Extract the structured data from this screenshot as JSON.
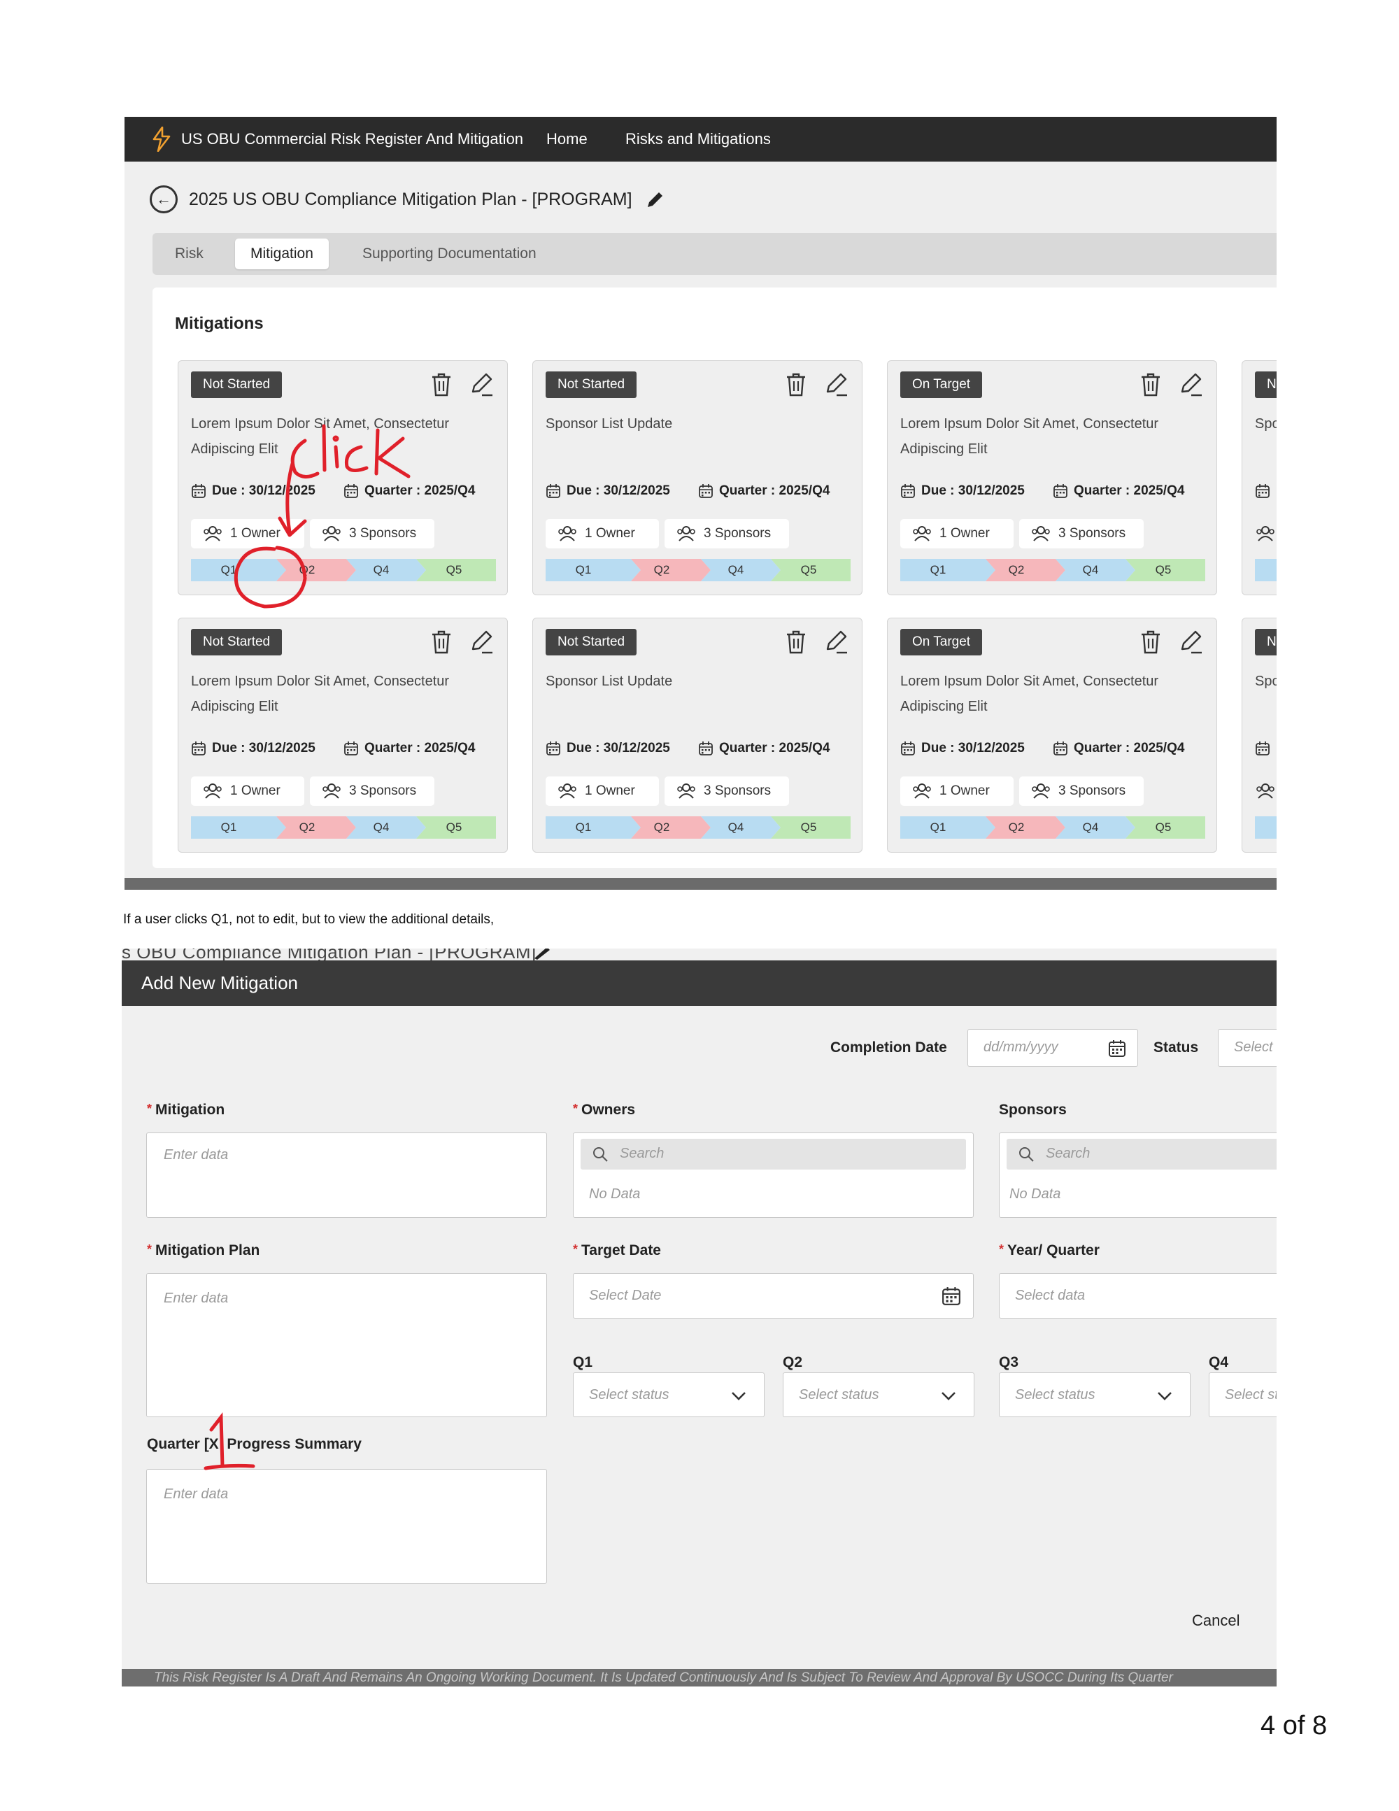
{
  "shot1": {
    "app_title": "US OBU Commercial Risk Register And Mitigation",
    "nav": [
      "Home",
      "Risks and Mitigations"
    ],
    "page_title": "2025 US OBU Compliance Mitigation Plan - [PROGRAM]",
    "tabs": [
      "Risk",
      "Mitigation",
      "Supporting Documentation"
    ],
    "active_tab": "Mitigation",
    "section_title": "Mitigations",
    "cards": [
      {
        "status": "Not Started",
        "title": "Lorem Ipsum Dolor Sit Amet, Consectetur Adipiscing Elit",
        "due_label": "Due :",
        "due": "30/12/2025",
        "quarter_label": "Quarter :",
        "quarter": "2025/Q4",
        "owners": "1 Owner",
        "sponsors": "3 Sponsors",
        "quarters": [
          "Q1",
          "Q2",
          "Q4",
          "Q5"
        ]
      },
      {
        "status": "Not Started",
        "title": "Sponsor List Update",
        "due_label": "Due :",
        "due": "30/12/2025",
        "quarter_label": "Quarter :",
        "quarter": "2025/Q4",
        "owners": "1 Owner",
        "sponsors": "3 Sponsors",
        "quarters": [
          "Q1",
          "Q2",
          "Q4",
          "Q5"
        ]
      },
      {
        "status": "On Target",
        "title": "Lorem Ipsum Dolor Sit Amet, Consectetur Adipiscing Elit",
        "due_label": "Due :",
        "due": "30/12/2025",
        "quarter_label": "Quarter :",
        "quarter": "2025/Q4",
        "owners": "1 Owner",
        "sponsors": "3 Sponsors",
        "quarters": [
          "Q1",
          "Q2",
          "Q4",
          "Q5"
        ]
      },
      {
        "status": "Not Started",
        "title": "Lorem Ipsum Dolor Sit Amet, Consectetur Adipiscing Elit",
        "due_label": "Due :",
        "due": "30/12/2025",
        "quarter_label": "Quarter :",
        "quarter": "2025/Q4",
        "owners": "1 Owner",
        "sponsors": "3 Sponsors",
        "quarters": [
          "Q1",
          "Q2",
          "Q4",
          "Q5"
        ]
      },
      {
        "status": "Not Started",
        "title": "Sponsor List Update",
        "due_label": "Due :",
        "due": "30/12/2025",
        "quarter_label": "Quarter :",
        "quarter": "2025/Q4",
        "owners": "1 Owner",
        "sponsors": "3 Sponsors",
        "quarters": [
          "Q1",
          "Q2",
          "Q4",
          "Q5"
        ]
      },
      {
        "status": "On Target",
        "title": "Lorem Ipsum Dolor Sit Amet, Consectetur Adipiscing Elit",
        "due_label": "Due :",
        "due": "30/12/2025",
        "quarter_label": "Quarter :",
        "quarter": "2025/Q4",
        "owners": "1 Owner",
        "sponsors": "3 Sponsors",
        "quarters": [
          "Q1",
          "Q2",
          "Q4",
          "Q5"
        ]
      }
    ],
    "partial_cards": [
      {
        "status": "No",
        "title": "Spo"
      },
      {
        "status": "No",
        "title": "Spo"
      }
    ],
    "quarter_colors": {
      "q1": "#b8dcf2",
      "q2": "#f6b7bb",
      "q4": "#b8dcf2",
      "q5": "#bfe8b5"
    },
    "annotation": "Click"
  },
  "caption": "If a user clicks Q1, not to edit, but to view the additional details,",
  "shot2": {
    "bg_title": "s OBU Compliance Mitigation Plan - [PROGRAM]",
    "modal_title": "Add New Mitigation",
    "completion_date_label": "Completion Date",
    "completion_date_placeholder": "dd/mm/yyyy",
    "status_label": "Status",
    "status_placeholder": "Select",
    "mitigation_label": "Mitigation",
    "mitigation_placeholder": "Enter data",
    "owners_label": "Owners",
    "owners_search": "Search",
    "owners_empty": "No Data",
    "sponsors_label": "Sponsors",
    "sponsors_search": "Search",
    "sponsors_empty": "No Data",
    "plan_label": "Mitigation Plan",
    "plan_placeholder": "Enter data",
    "target_label": "Target Date",
    "target_placeholder": "Select Date",
    "yq_label": "Year/ Quarter",
    "yq_placeholder": "Select data",
    "q_labels": [
      "Q1",
      "Q2",
      "Q3",
      "Q4"
    ],
    "q_placeholders": [
      "Select status",
      "Select status",
      "Select status",
      "Select sta"
    ],
    "summary_label_pre": "Quarter [X",
    "summary_label_post": "Progress Summary",
    "summary_placeholder": "Enter data",
    "cancel": "Cancel",
    "disclaimer": "This Risk Register Is A Draft And Remains An Ongoing Working Document. It Is Updated Continuously And Is Subject To Review And Approval By USOCC During Its Quarter"
  },
  "page_number": "4 of 8",
  "colors": {
    "topbar": "#2b2b2b",
    "status_badge": "#444444",
    "annotation_red": "#e0202a",
    "required": "#d32f2f"
  }
}
